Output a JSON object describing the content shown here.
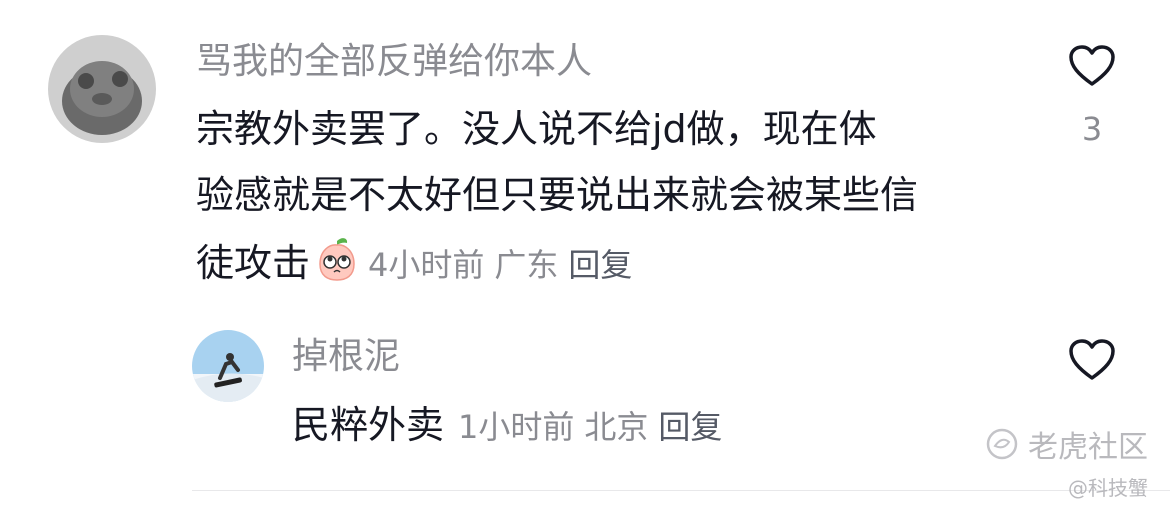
{
  "comment": {
    "username": "骂我的全部反弹给你本人",
    "lines": [
      "宗教外卖罢了。没人说不给jd做，现在体",
      "验感就是不太好但只要说出来就会被某些信",
      "徒攻击"
    ],
    "emoji_icon": "peach-face-emoji",
    "time": "4小时前",
    "location": "广东",
    "reply_label": "回复",
    "like_count": "3"
  },
  "reply": {
    "username": "掉根泥",
    "text": "民粹外卖",
    "time": "1小时前",
    "location": "北京",
    "reply_label": "回复"
  },
  "watermark": {
    "brand": "老虎社区",
    "handle": "@科技蟹"
  },
  "colors": {
    "primary_text": "#161823",
    "secondary_text": "#8a8b91",
    "background": "#ffffff"
  }
}
